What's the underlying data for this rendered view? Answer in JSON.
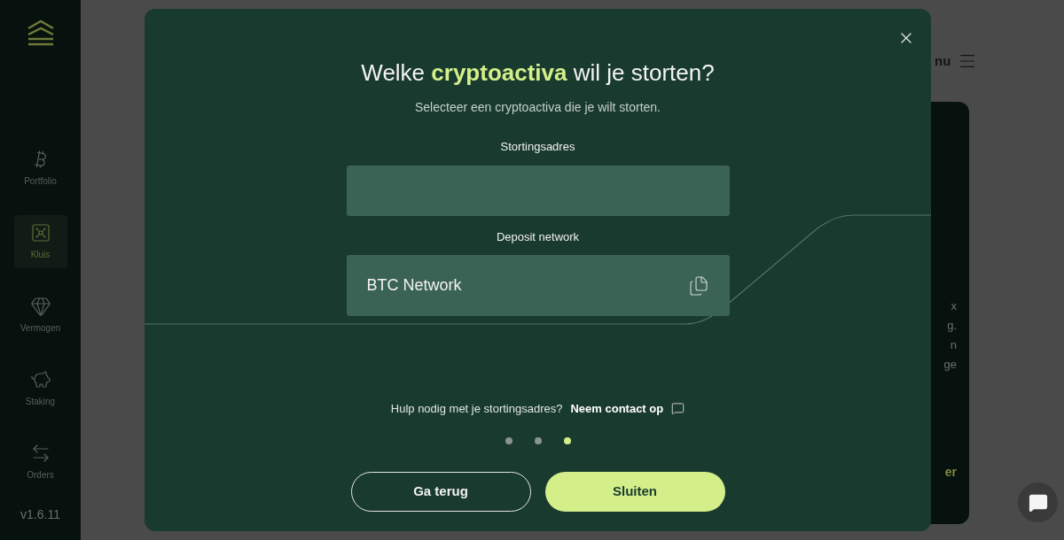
{
  "sidebar": {
    "items": [
      {
        "kind": "bitcoin",
        "label": "Portfolio",
        "selected": false
      },
      {
        "kind": "safe",
        "label": "Kluis",
        "selected": true
      },
      {
        "kind": "diamond",
        "label": "Vermogen",
        "selected": false
      },
      {
        "kind": "piggy",
        "label": "Staking",
        "selected": false
      },
      {
        "kind": "swap",
        "label": "Orders",
        "selected": false
      }
    ],
    "version": "v1.6.11"
  },
  "background": {
    "menu_label": "nu",
    "card_fragments": [
      "x",
      "g.",
      "n",
      "ge"
    ],
    "card_link": "er"
  },
  "modal": {
    "title": "Welke **cryptoactiva** wil je storten?",
    "subtitle": "Selecteer een cryptoactiva die je wilt storten.",
    "fields": [
      {
        "label": "Stortingsadres"
      },
      {
        "label": "Deposit network",
        "value": "BTC Network"
      }
    ],
    "help_text": "Hulp nodig met je stortingsadres?",
    "help_link": "Neem contact op",
    "steps": [
      {
        "selected": false
      },
      {
        "selected": false
      },
      {
        "selected": true
      }
    ],
    "buttons": [
      {
        "kind": "secondary",
        "label": "Ga terug"
      },
      {
        "kind": "primary",
        "label": "Sluiten"
      }
    ]
  }
}
